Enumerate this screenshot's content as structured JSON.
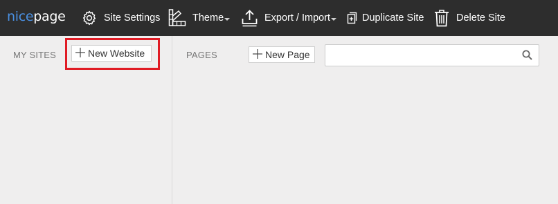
{
  "brand": {
    "logo_part1": "nice",
    "logo_part2": "page",
    "accent": "#4a90e2"
  },
  "toolbar": {
    "site_settings": "Site Settings",
    "theme": "Theme",
    "export_import": "Export / Import",
    "duplicate_site": "Duplicate Site",
    "delete_site": "Delete Site"
  },
  "sites": {
    "title": "MY SITES",
    "new_website": "New Website"
  },
  "pages": {
    "title": "PAGES",
    "new_page": "New Page"
  },
  "search": {
    "value": "",
    "placeholder": ""
  },
  "colors": {
    "topbar": "#2d2d2d",
    "background": "#efeeee",
    "highlight": "#e01b24"
  }
}
